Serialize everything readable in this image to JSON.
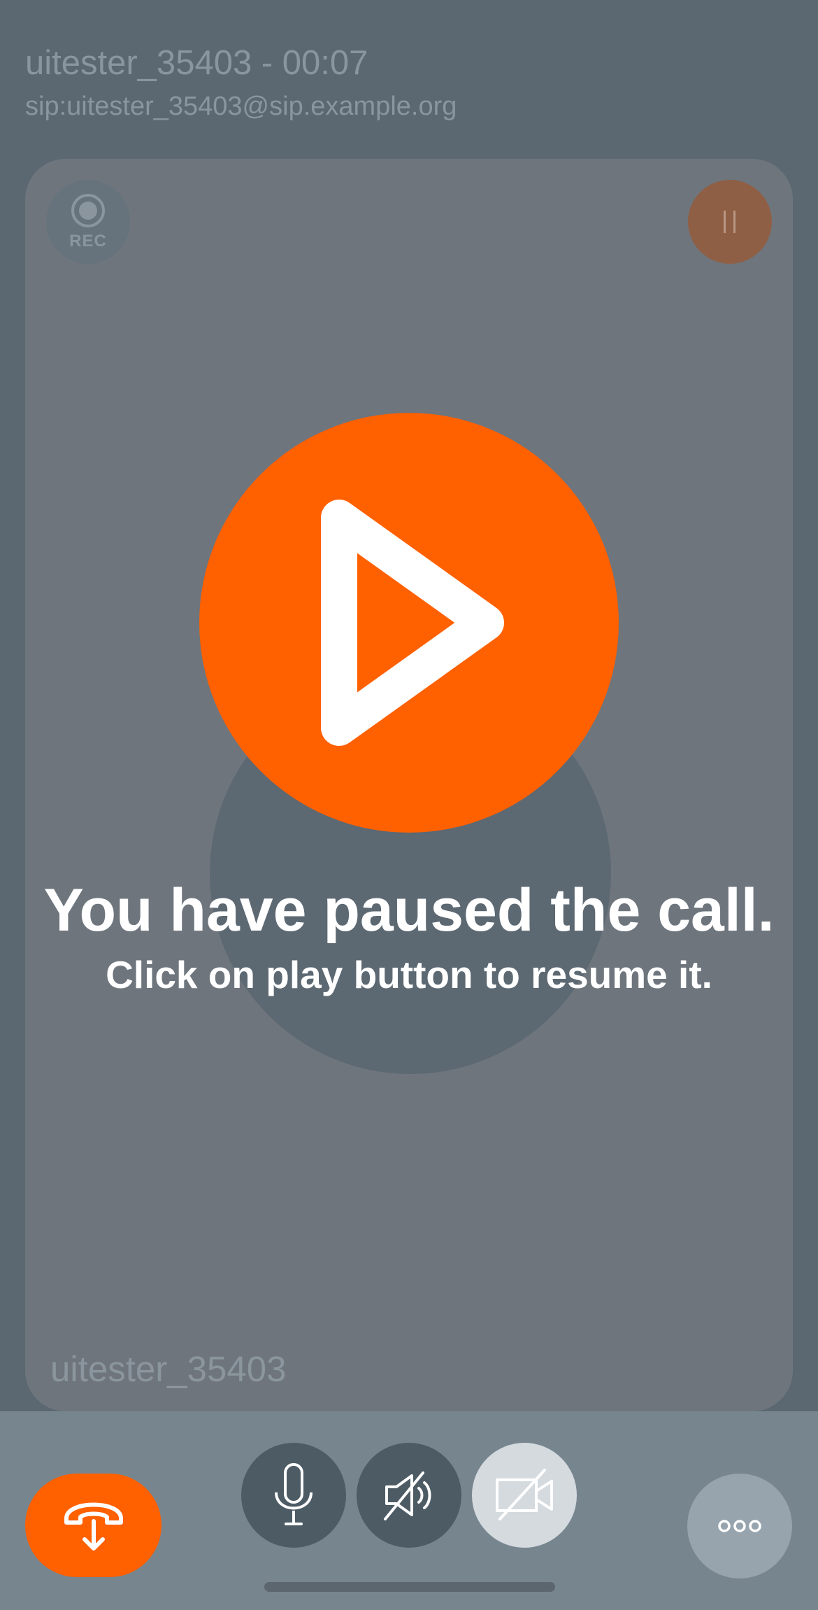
{
  "header": {
    "title": "uitester_35403 - 00:07",
    "address": "sip:uitester_35403@sip.example.org"
  },
  "video": {
    "rec_label": "REC",
    "participant_name": "uitester_35403"
  },
  "paused_overlay": {
    "title": "You have paused the call.",
    "subtitle": "Click on play button to resume it."
  },
  "controls": {
    "hangup_icon": "hangup-icon",
    "mic_icon": "microphone-icon",
    "speaker_icon": "speaker-muted-icon",
    "camera_icon": "camera-off-icon",
    "more_icon": "more-icon"
  },
  "colors": {
    "accent": "#ff6000",
    "background": "#5b6872",
    "card": "#6e757d",
    "controls_bar": "#77858f"
  }
}
